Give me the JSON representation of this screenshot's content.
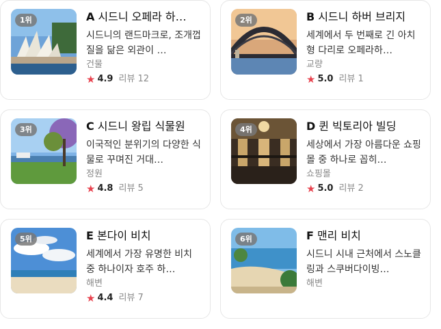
{
  "places": [
    {
      "rank": "1위",
      "letter": "A",
      "name": "시드니 오페라 하…",
      "desc": "시드니의 랜드마크로, 조개껍질을 닮은 외관이 …",
      "category": "건물",
      "score": "4.9",
      "reviews": "리뷰 12"
    },
    {
      "rank": "2위",
      "letter": "B",
      "name": "시드니 하버 브리지",
      "desc": "세계에서 두 번째로 긴 아치형 다리로 오페라하…",
      "category": "교량",
      "score": "5.0",
      "reviews": "리뷰 1"
    },
    {
      "rank": "3위",
      "letter": "C",
      "name": "시드니 왕립 식물원",
      "desc": "이국적인 분위기의 다양한 식물로 꾸며진 거대…",
      "category": "정원",
      "score": "4.8",
      "reviews": "리뷰 5"
    },
    {
      "rank": "4위",
      "letter": "D",
      "name": "퀸 빅토리아 빌딩",
      "desc": "세상에서 가장 아름다운 쇼핑몰 중 하나로 꼽히…",
      "category": "쇼핑몰",
      "score": "5.0",
      "reviews": "리뷰 2"
    },
    {
      "rank": "5위",
      "letter": "E",
      "name": "본다이 비치",
      "desc": "세계에서 가장 유명한 비치 중 하나이자 호주 하…",
      "category": "해변",
      "score": "4.4",
      "reviews": "리뷰 7"
    },
    {
      "rank": "6위",
      "letter": "F",
      "name": "맨리 비치",
      "desc": "시드니 시내 근처에서 스노클링과 스쿠버다이빙…",
      "category": "해변",
      "score": "",
      "reviews": ""
    }
  ],
  "icons": {
    "star": "star-icon"
  },
  "colors": {
    "star": "#e8434f"
  }
}
